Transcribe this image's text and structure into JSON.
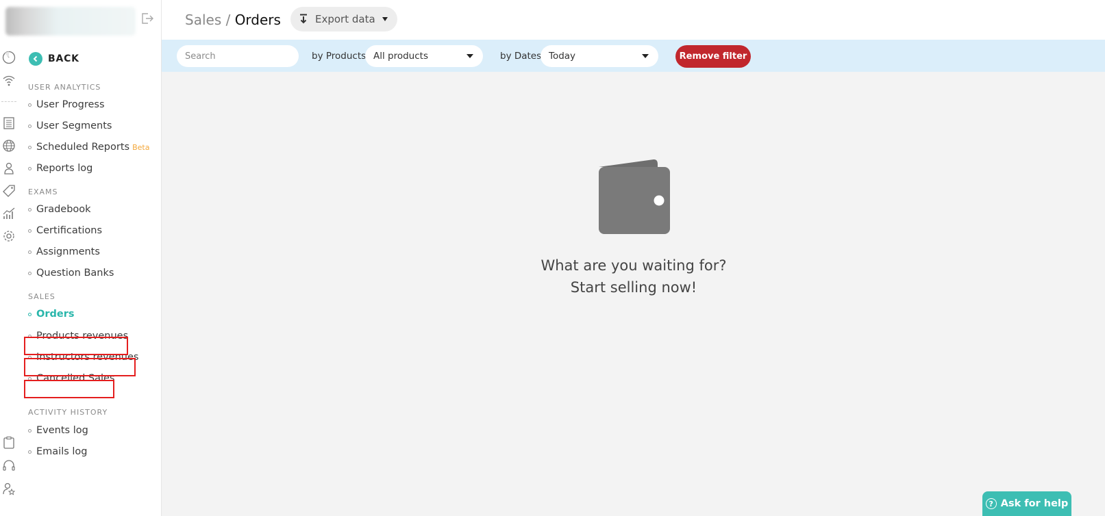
{
  "header": {
    "breadcrumb_parent": "Sales",
    "breadcrumb_sep": " / ",
    "breadcrumb_current": "Orders",
    "export_label": "Export data"
  },
  "sidebar": {
    "back_label": "BACK",
    "sections": {
      "user_analytics": "USER ANALYTICS",
      "exams": "EXAMS",
      "sales": "SALES",
      "activity_history": "ACTIVITY HISTORY"
    },
    "items": {
      "user_progress": "User Progress",
      "user_segments": "User Segments",
      "scheduled_reports": "Scheduled Reports",
      "scheduled_reports_badge": "Beta",
      "reports_log": "Reports log",
      "gradebook": "Gradebook",
      "certifications": "Certifications",
      "assignments": "Assignments",
      "question_banks": "Question Banks",
      "orders": "Orders",
      "products_revenues": "Products revenues",
      "instructors_revenues": "Instructors revenues",
      "cancelled_sales": "Cancelled Sales",
      "events_log": "Events log",
      "emails_log": "Emails log"
    }
  },
  "filters": {
    "search_placeholder": "Search",
    "products_label": "by Products:",
    "products_value": "All products",
    "dates_label": "by Dates:",
    "dates_value": "Today",
    "remove_label": "Remove filter"
  },
  "empty_state": {
    "line1": "What are you waiting for?",
    "line2": "Start selling now!"
  },
  "help": {
    "label": "Ask for help"
  },
  "colors": {
    "accent": "#3dbeb3",
    "danger": "#c1272d",
    "highlight": "#e41e1e",
    "filterbar": "#dbeefa"
  }
}
